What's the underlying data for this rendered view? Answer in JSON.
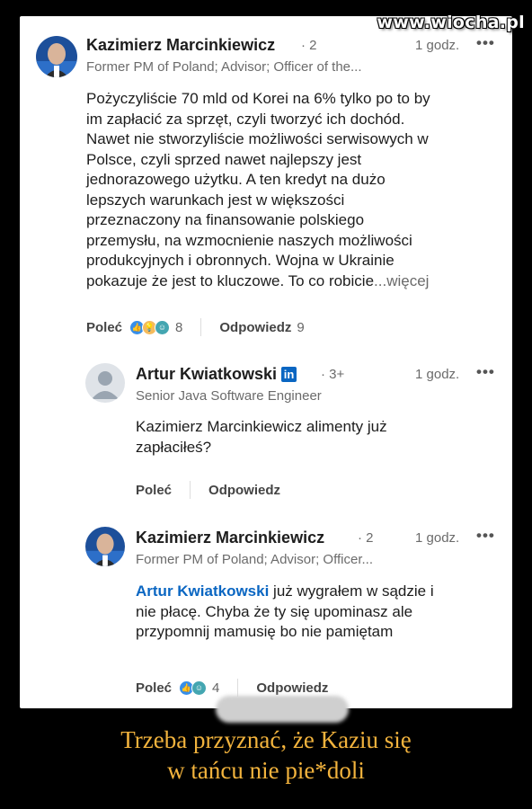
{
  "watermark": "www.wiocha.pl",
  "comments": [
    {
      "author": "Kazimierz Marcinkiewicz",
      "degree": "· 2",
      "time": "1 godz.",
      "headline": "Former PM of Poland; Advisor; Officer of the...",
      "lines": [
        "Pożyczyliście 70 mld od Korei na 6% tylko po to by",
        "im zapłacić za sprzęt, czyli tworzyć ich dochód.",
        "Nawet nie stworzyliście możliwości serwisowych w",
        "Polsce, czyli sprzed nawet najlepszy jest",
        "jednorazowego użytku. A ten kredyt na dużo",
        "lepszych warunkach jest w większości",
        "przeznaczony na finansowanie polskiego",
        "przemysłu, na wzmocnienie naszych możliwości",
        "produkcyjnych i obronnych. Wojna w Ukrainie",
        "pokazuje że jest to kluczowe. To co robicie"
      ],
      "more_label": "...więcej",
      "like_label": "Poleć",
      "reaction_count": "8",
      "reply_label": "Odpowiedz",
      "reply_count": "9",
      "reactions": [
        "like",
        "insightful",
        "funny"
      ]
    },
    {
      "author": "Artur Kwiatkowski",
      "degree": "· 3+",
      "time": "1 godz.",
      "headline": "Senior Java Software Engineer",
      "lines": [
        "Kazimierz Marcinkiewicz  alimenty już",
        "zapłaciłeś?"
      ],
      "like_label": "Poleć",
      "reply_label": "Odpowiedz",
      "in_badge": "in"
    },
    {
      "author": "Kazimierz Marcinkiewicz",
      "degree": "· 2",
      "time": "1 godz.",
      "headline": "Former PM of Poland; Advisor; Officer...",
      "mention": "Artur Kwiatkowski",
      "line1_rest": " już wygrałem w sądzie i",
      "lines": [
        "nie płacę. Chyba że ty się upominasz ale",
        "przypomnij mamusię bo nie pamiętam"
      ],
      "like_label": "Poleć",
      "reaction_count": "4",
      "reply_label": "Odpowiedz",
      "reactions": [
        "like",
        "funny"
      ]
    }
  ],
  "caption": [
    "Trzeba przyznać, że Kaziu się",
    "w tańcu nie pie*doli"
  ],
  "colors": {
    "like": "#378fe9",
    "insightful": "#f5bb5c",
    "funny": "#44a6b1",
    "link": "#0a66c2",
    "caption": "#f2b33d"
  }
}
